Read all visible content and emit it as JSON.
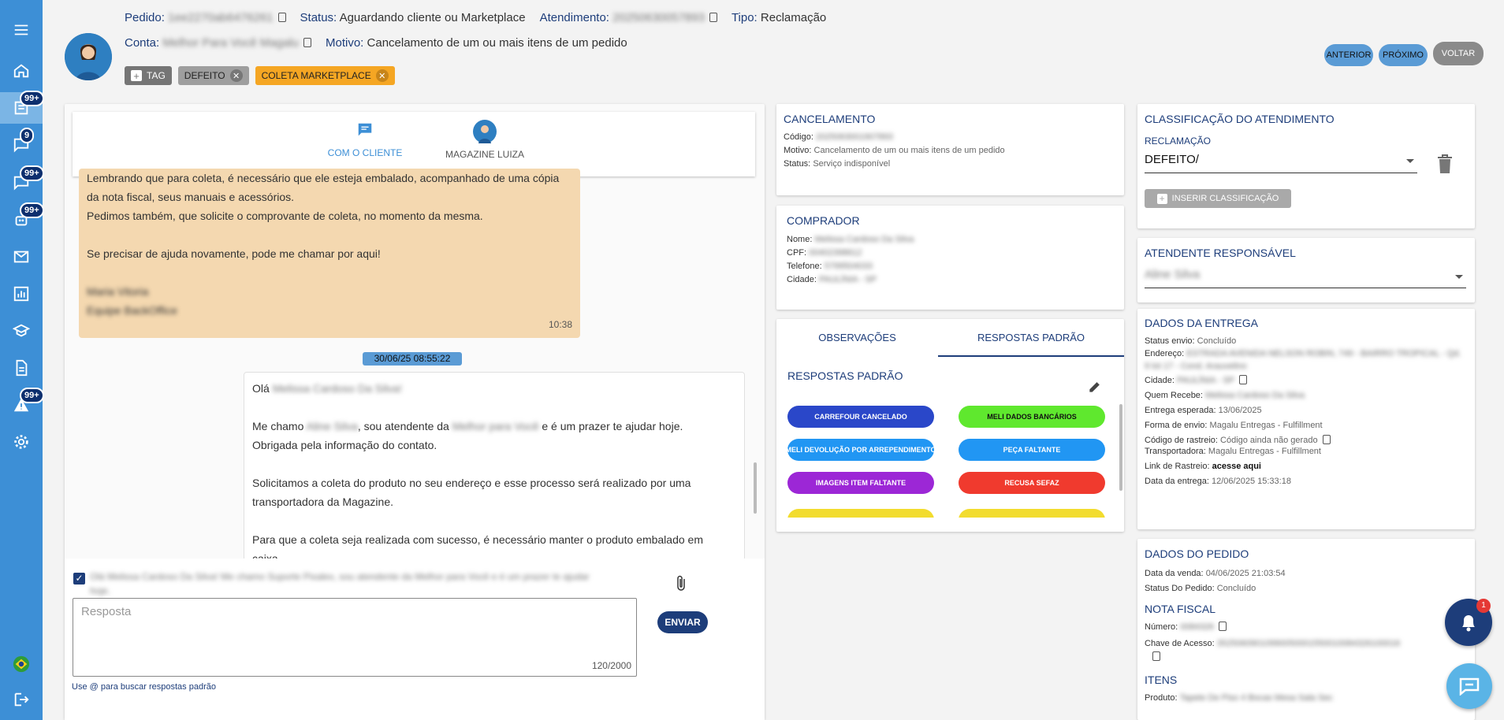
{
  "sidebar": {
    "badges": {
      "chat": "99+",
      "messages": "9",
      "chat2": "99+",
      "bot": "99+",
      "alerts": "99+"
    }
  },
  "header": {
    "pedido_label": "Pedido:",
    "pedido_value": "1ee2270ab6476261",
    "status_label": "Status:",
    "status_value": "Aguardando cliente ou Marketplace",
    "atendimento_label": "Atendimento:",
    "atendimento_value": "20250630057893",
    "tipo_label": "Tipo:",
    "tipo_value": "Reclamação",
    "conta_label": "Conta:",
    "conta_value": "Melhor Para Você Magalu",
    "motivo_label": "Motivo:",
    "motivo_value": "Cancelamento de um ou mais itens de um pedido",
    "tags": [
      {
        "label": "TAG",
        "color": "#757575"
      },
      {
        "label": "DEFEITO",
        "color": "#9e9e9e"
      },
      {
        "label": "COLETA MARKETPLACE",
        "color": "#f5a623"
      }
    ],
    "btn_anterior": "ANTERIOR",
    "btn_proximo": "PRÓXIMO",
    "btn_voltar": "VOLTAR"
  },
  "chat": {
    "tab_cliente": "COM O CLIENTE",
    "tab_magazine": "MAGAZINE LUIZA",
    "msg1": {
      "line1": "Lembrando que para coleta, é necessário que ele esteja embalado, acompanhado de uma cópia",
      "line2": "da nota fiscal, seus manuais e acessórios.",
      "line3": "Pedimos também, que solicite o comprovante de coleta, no momento da mesma.",
      "line4": "Se precisar de ajuda novamente, pode me chamar por aqui!",
      "sign1": "Maria Vitoria",
      "sign2": "Equipe BackOffice",
      "time": "10:38"
    },
    "date_chip": "30/06/25 08:55:22",
    "msg2": {
      "ola": "Olá",
      "ola_name": "Melissa Cardoso Da Silva!",
      "me_chamo": "Me chamo",
      "agent_name": "Aline Silva",
      "sou": ", sou atendente da",
      "store": "Melhor para Você",
      "prazer": "e é um prazer te ajudar hoje.",
      "obrigada": "Obrigada pela informação do contato.",
      "solicitamos1": "Solicitamos a coleta do produto no seu endereço e esse processo será realizado por uma",
      "solicitamos2": "transportadora da Magazine.",
      "para1": "Para que a coleta seja realizada com sucesso, é necessário manter o produto embalado em",
      "para2": "caixa"
    },
    "template_preview": "Olá Melissa Cardoso Da Silva! Me chamo Suporte Pixalex, sou atendente da Melhor para Você e é um prazer te ajudar hoje.",
    "reply_placeholder": "Resposta",
    "counter": "120/2000",
    "send_label": "ENVIAR",
    "hint": "Use @ para buscar respostas padrão"
  },
  "cancelamento": {
    "title": "CANCELAMENTO",
    "codigo_label": "Código:",
    "codigo_value": "2025063001907893",
    "motivo_label": "Motivo:",
    "motivo_value": "Cancelamento de um ou mais itens de um pedido",
    "status_label": "Status:",
    "status_value": "Serviço indisponível"
  },
  "comprador": {
    "title": "COMPRADOR",
    "nome_label": "Nome:",
    "nome_value": "Melissa Cardoso Da Silva",
    "cpf_label": "CPF:",
    "cpf_value": "00402398612",
    "telefone_label": "Telefone:",
    "telefone_value": "5799504033",
    "cidade_label": "Cidade:",
    "cidade_value": "PAULÍNIA - SP"
  },
  "respostas": {
    "tab_obs": "OBSERVAÇÕES",
    "tab_resp": "RESPOSTAS PADRÃO",
    "section_title": "RESPOSTAS PADRÃO",
    "chips": [
      {
        "label": "CARREFOUR CANCELADO",
        "color": "#2a47c9"
      },
      {
        "label": "MELI DADOS BANCÁRIOS",
        "color": "#5fe82e"
      },
      {
        "label": "MELI DEVOLUÇÃO POR ARREPENDIMENTO",
        "color": "#2196f3"
      },
      {
        "label": "PEÇA FALTANTE",
        "color": "#2196f3"
      },
      {
        "label": "IMAGENS ITEM FALTANTE",
        "color": "#9c27d6"
      },
      {
        "label": "RECUSA SEFAZ",
        "color": "#f03a2e"
      },
      {
        "label": "",
        "color": "#f2dc2e"
      },
      {
        "label": "",
        "color": "#f2dc2e"
      }
    ]
  },
  "classificacao": {
    "title": "CLASSIFICAÇÃO DO ATENDIMENTO",
    "sub": "RECLAMAÇÃO",
    "value": "DEFEITO/",
    "insert_label": "INSERIR CLASSIFICAÇÃO"
  },
  "responsavel": {
    "title": "ATENDENTE RESPONSÁVEL",
    "value": "Aline Silva"
  },
  "entrega": {
    "title": "DADOS DA ENTREGA",
    "status_label": "Status envio:",
    "status_value": "Concluído",
    "endereco_label": "Endereço:",
    "endereco_value": "ESTRADA AVENIDA NELSON ROBIN, 749 - BAIRRO TROPICAL - Qd. 9 lot 17 - Cond. Arauvelino",
    "cidade_label": "Cidade:",
    "cidade_value": "PAULÍNIA - SP",
    "quem_label": "Quem Recebe:",
    "quem_value": "Melissa Cardoso Da Silva",
    "esperada_label": "Entrega esperada:",
    "esperada_value": "13/06/2025",
    "forma_label": "Forma de envio:",
    "forma_value": "Magalu Entregas - Fulfillment",
    "codigo_label": "Código de rastreio:",
    "codigo_value": "Código ainda não gerado",
    "transp_label": "Transportadora:",
    "transp_value": "Magalu Entregas - Fulfillment",
    "link_label": "Link de Rastreio:",
    "link_value": "acesse aqui",
    "data_label": "Data da entrega:",
    "data_value": "12/06/2025 15:33:18"
  },
  "pedido": {
    "title": "DADOS DO PEDIDO",
    "venda_label": "Data da venda:",
    "venda_value": "04/06/2025 21:03:54",
    "status_label": "Status Do Pedido:",
    "status_value": "Concluído",
    "nf_title": "NOTA FISCAL",
    "numero_label": "Número:",
    "numero_value": "0084326",
    "chave_label": "Chave de Acesso:",
    "chave_value": "35250609010990050001550010084326100016",
    "itens_title": "ITENS",
    "produto_label": "Produto:",
    "produto_value": "Tapete De Piso 4 Bocas Mesa Sala Sec"
  },
  "notifications": {
    "count": "1"
  }
}
